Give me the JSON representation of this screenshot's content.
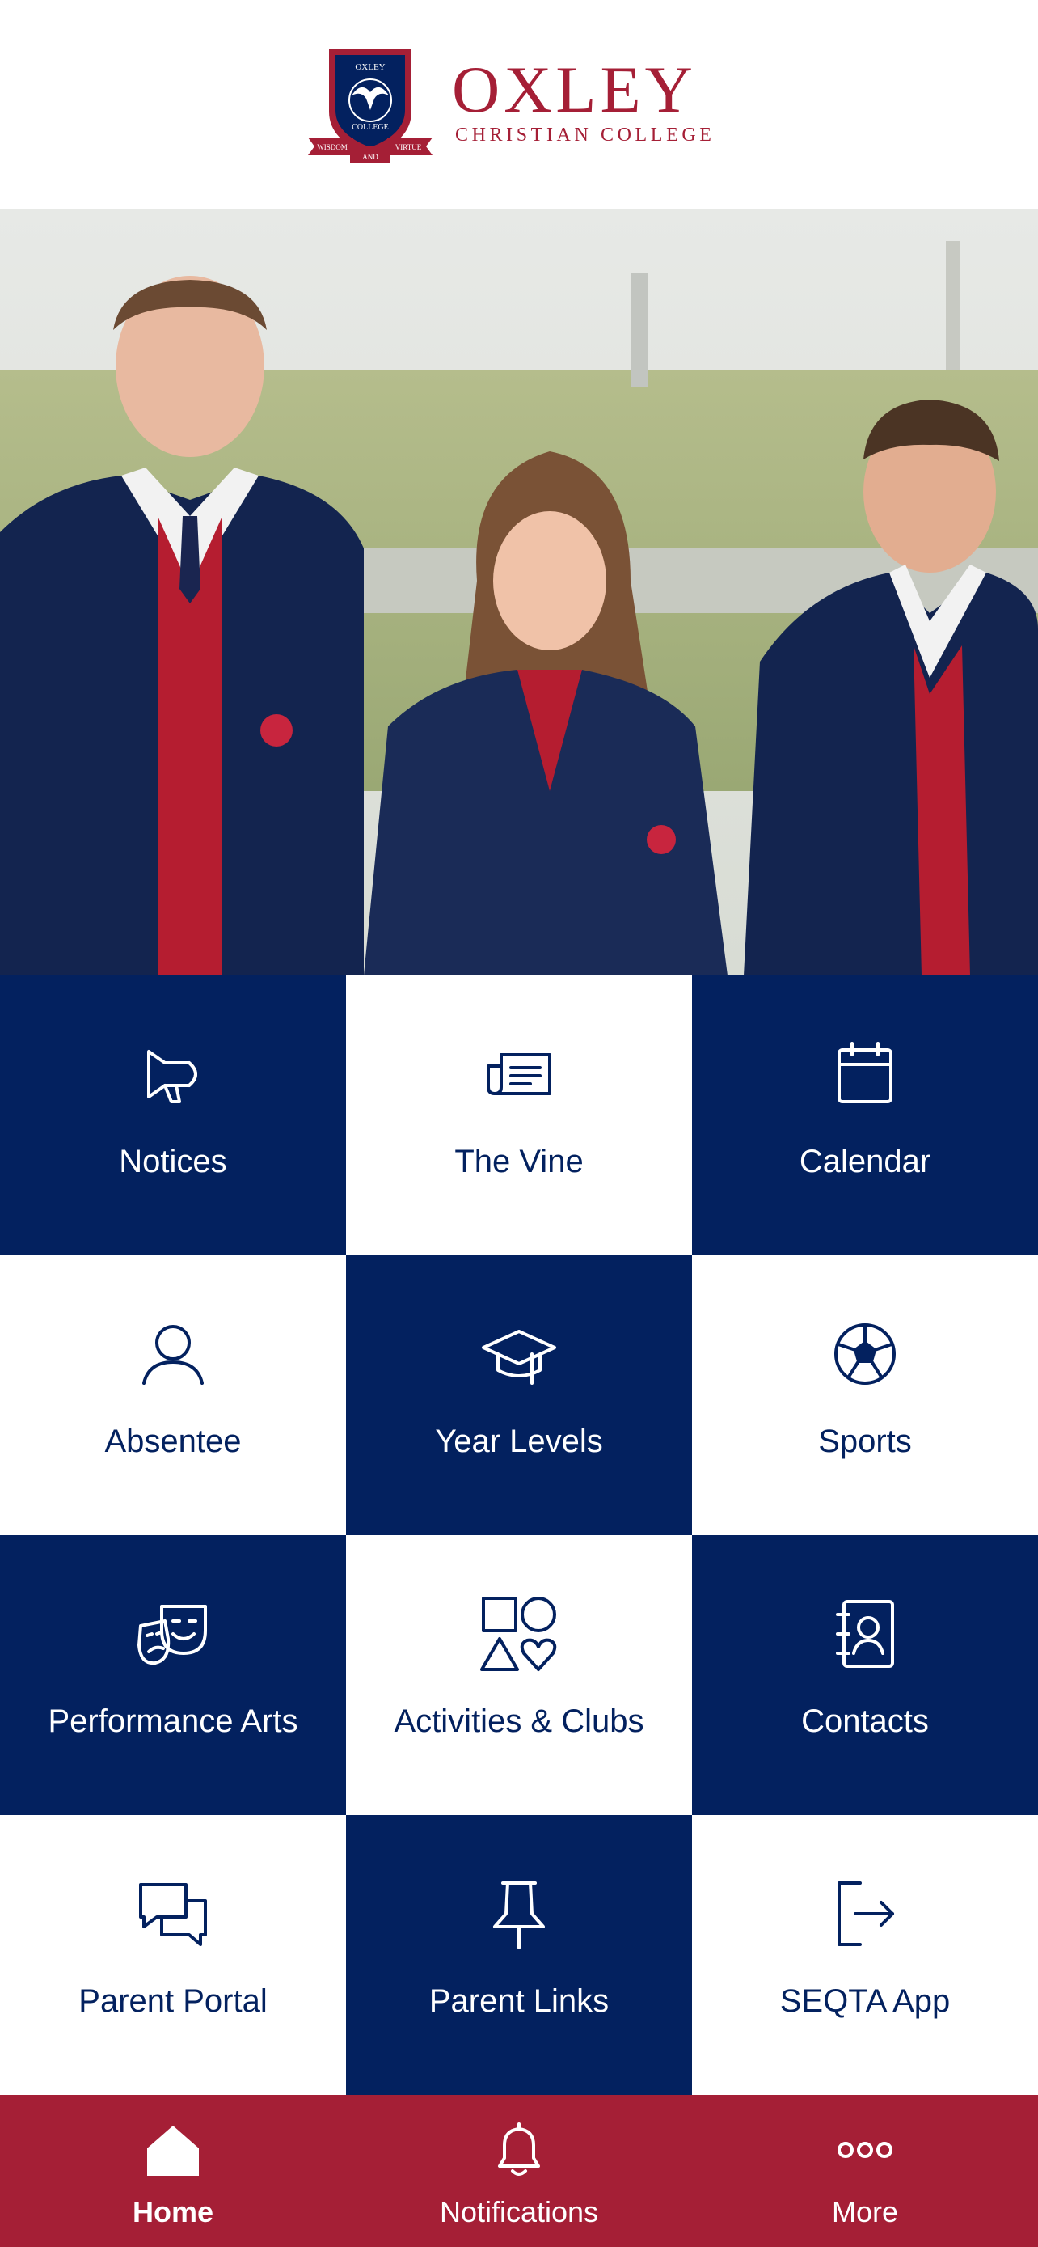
{
  "brand": {
    "name": "OXLEY",
    "subtitle": "CHRISTIAN COLLEGE",
    "crest_top": "OXLEY",
    "crest_bottom": "COLLEGE",
    "motto_left": "WISDOM",
    "motto_center": "AND",
    "motto_right": "VIRTUE",
    "color": "#a51f36"
  },
  "hero": {
    "description_icon": "students-photo"
  },
  "tiles": [
    {
      "label": "Notices",
      "icon": "megaphone-icon",
      "theme": "dark"
    },
    {
      "label": "The Vine",
      "icon": "newspaper-icon",
      "theme": "light"
    },
    {
      "label": "Calendar",
      "icon": "calendar-icon",
      "theme": "dark"
    },
    {
      "label": "Absentee",
      "icon": "person-icon",
      "theme": "light"
    },
    {
      "label": "Year Levels",
      "icon": "graduation-cap-icon",
      "theme": "dark"
    },
    {
      "label": "Sports",
      "icon": "soccer-ball-icon",
      "theme": "light"
    },
    {
      "label": "Performance Arts",
      "icon": "theater-masks-icon",
      "theme": "dark"
    },
    {
      "label": "Activities & Clubs",
      "icon": "shapes-icon",
      "theme": "light"
    },
    {
      "label": "Contacts",
      "icon": "address-book-icon",
      "theme": "dark"
    },
    {
      "label": "Parent Portal",
      "icon": "chat-bubbles-icon",
      "theme": "light"
    },
    {
      "label": "Parent Links",
      "icon": "pushpin-icon",
      "theme": "dark"
    },
    {
      "label": "SEQTA App",
      "icon": "sign-out-icon",
      "theme": "light"
    }
  ],
  "tabbar": {
    "items": [
      {
        "label": "Home",
        "icon": "home-icon",
        "active": true
      },
      {
        "label": "Notifications",
        "icon": "bell-icon",
        "active": false
      },
      {
        "label": "More",
        "icon": "more-dots-icon",
        "active": false
      }
    ]
  },
  "colors": {
    "navy": "#03215f",
    "crimson": "#a51f36",
    "white": "#ffffff"
  }
}
